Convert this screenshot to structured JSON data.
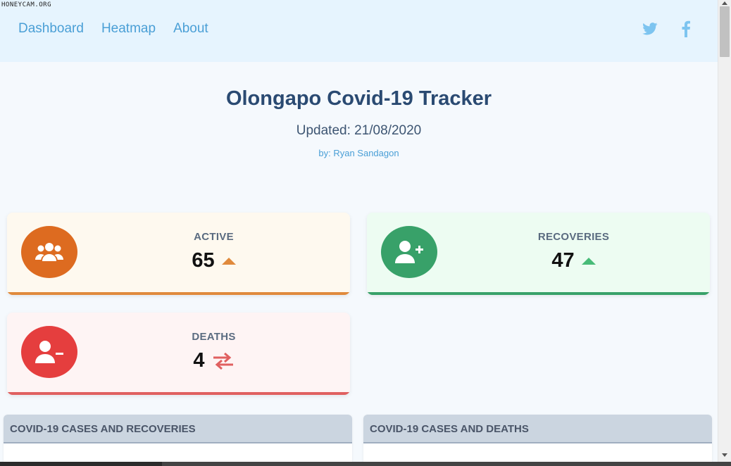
{
  "watermark": "HONEYCAM.ORG",
  "nav": {
    "links": [
      "Dashboard",
      "Heatmap",
      "About"
    ],
    "social_icons": [
      "twitter-icon",
      "facebook-icon"
    ]
  },
  "header": {
    "title": "Olongapo Covid-19 Tracker",
    "updated": "Updated: 21/08/2020",
    "author": "by: Ryan Sandagon"
  },
  "cards": {
    "active": {
      "label": "ACTIVE",
      "value": "65",
      "trend_icon": "triangle-up-icon",
      "icon": "users-group-icon",
      "color": "#dd6b20",
      "trend_color": "#e08a3c"
    },
    "recoveries": {
      "label": "RECOVERIES",
      "value": "47",
      "trend_icon": "triangle-up-icon",
      "icon": "user-plus-icon",
      "color": "#38a169",
      "trend_color": "#48bb78"
    },
    "deaths": {
      "label": "DEATHS",
      "value": "4",
      "trend_icon": "exchange-arrows-icon",
      "icon": "user-minus-icon",
      "color": "#e53e3e",
      "trend_color": "#e06060"
    }
  },
  "panels": {
    "left": {
      "title": "COVID-19 CASES AND RECOVERIES"
    },
    "right": {
      "title": "COVID-19 CASES AND DEATHS"
    }
  },
  "colors": {
    "navbar_bg": "#e6f4fe",
    "link": "#4a9fd6",
    "title": "#2a4a72"
  }
}
